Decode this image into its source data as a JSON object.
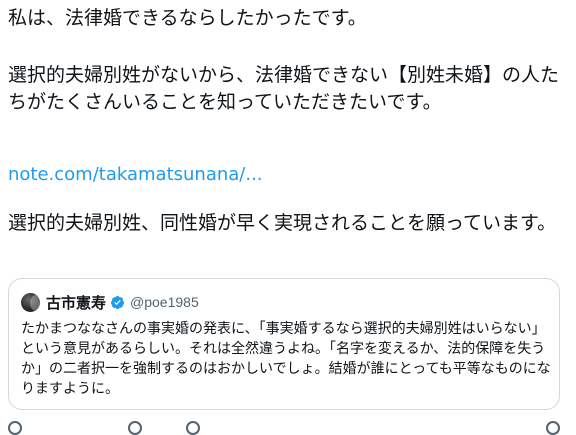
{
  "tweet": {
    "line1": "私は、法律婚できるならしたかったです。",
    "line2": "選択的夫婦別姓がないから、法律婚できない【別姓未婚】の人たちがたくさんいることを知っていただきたいです。",
    "link": "note.com/takamatsunana/...",
    "line3": "選択的夫婦別姓、同性婚が早く実現されることを願っています。"
  },
  "quote": {
    "author_name": "古市憲寿",
    "author_handle": "@poe1985",
    "body": "たかまつななさんの事実婚の発表に、「事実婚するなら選択的夫婦別姓はいらない」という意見があるらしい。それは全然違うよね。「名字を変えるか、法的保障を失うか」の二者択一を強制するのはおかしいでしょ。結婚が誰にとっても平等なものになりますように。"
  },
  "colors": {
    "link": "#1d9bf0",
    "verified": "#1d9bf0",
    "border": "#cfd9de",
    "muted": "#536471"
  }
}
